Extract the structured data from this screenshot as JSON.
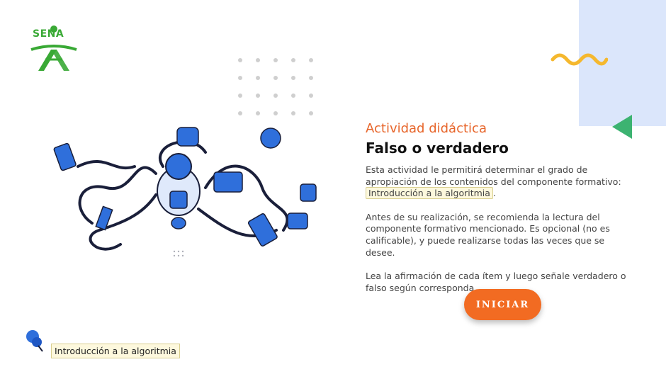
{
  "logo": {
    "text": "SENA"
  },
  "activity": {
    "kicker": "Actividad didáctica",
    "title": "Falso o verdadero",
    "p1_before": "Esta actividad le permitirá determinar el grado de apropiación de los contenidos del componente formativo: ",
    "p1_highlight": "Introducción a la algoritmia",
    "p1_after": ".",
    "p2": "Antes de su realización, se recomienda la lectura del componente formativo mencionado.  Es opcional (no es calificable), y puede realizarse todas las veces que se desee.",
    "p3": "Lea la afirmación de cada ítem y luego señale verdadero o falso según corresponda.",
    "start_label": "INICIAR"
  },
  "footer": {
    "tag": "Introducción a la algoritmia"
  },
  "icons": [
    "sena-logo-icon",
    "wave-icon",
    "triangle-icon",
    "robot-illustration",
    "pin-icon"
  ],
  "colors": {
    "accent": "#f26b22",
    "kicker": "#e7652a",
    "brand_green": "#39a935",
    "panel_blue": "#dbe6fb",
    "wave_yellow": "#f5b82e",
    "illus_blue": "#2f6fdb"
  }
}
